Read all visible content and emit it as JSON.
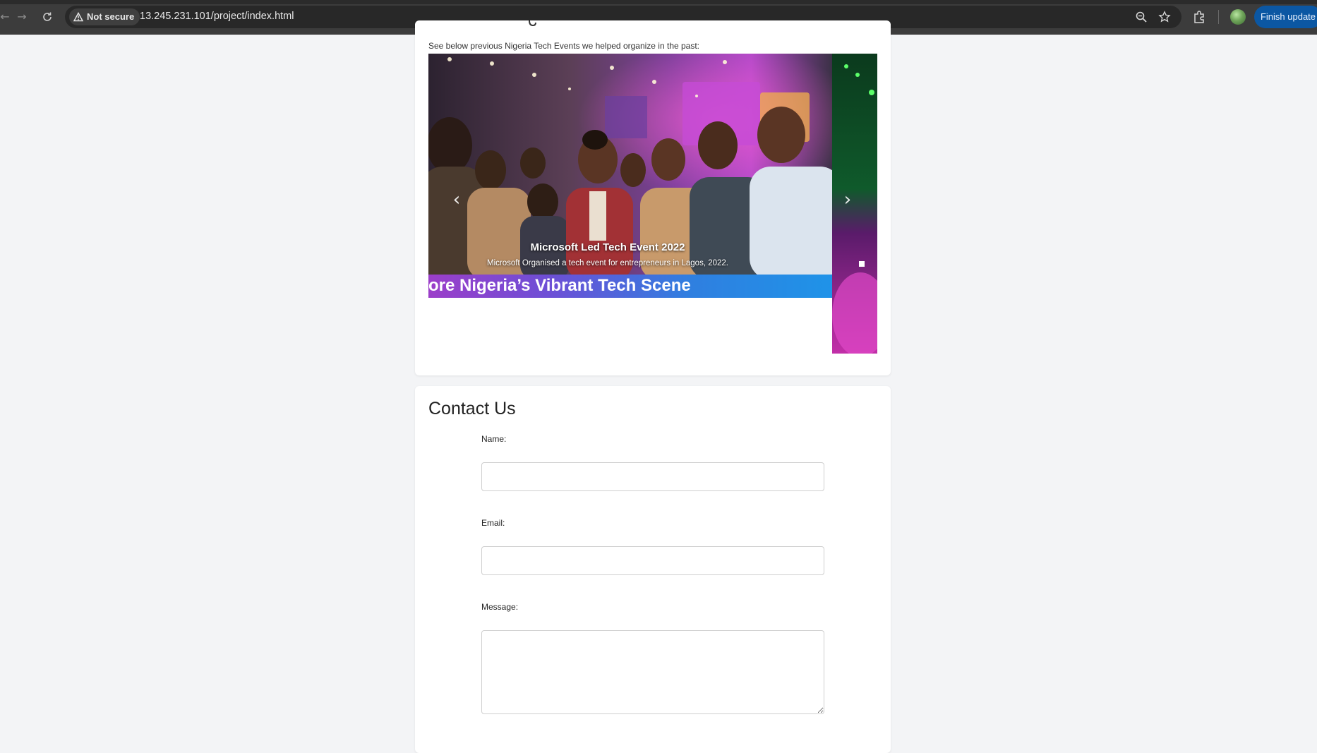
{
  "browser": {
    "security_label": "Not secure",
    "url": "13.245.231.101/project/index.html",
    "finish_update_label": "Finish update"
  },
  "events": {
    "subtitle": "See below previous Nigeria Tech Events we helped organize in the past:",
    "slide": {
      "caption_title": "Microsoft Led Tech Event 2022",
      "caption_text": "Microsoft Organised a tech event for entrepreneurs in Lagos, 2022.",
      "banner_text": "ore Nigeria’s Vibrant Tech Scene"
    },
    "prev_icon": "chevron-left-icon",
    "next_icon": "chevron-right-icon"
  },
  "contact": {
    "title": "Contact Us",
    "name_label": "Name:",
    "email_label": "Email:",
    "message_label": "Message:",
    "name_value": "",
    "email_value": "",
    "message_value": ""
  },
  "colors": {
    "chrome_bg": "#3c3c3c",
    "page_bg": "#f3f4f6",
    "finish_button": "#0b57a3"
  }
}
